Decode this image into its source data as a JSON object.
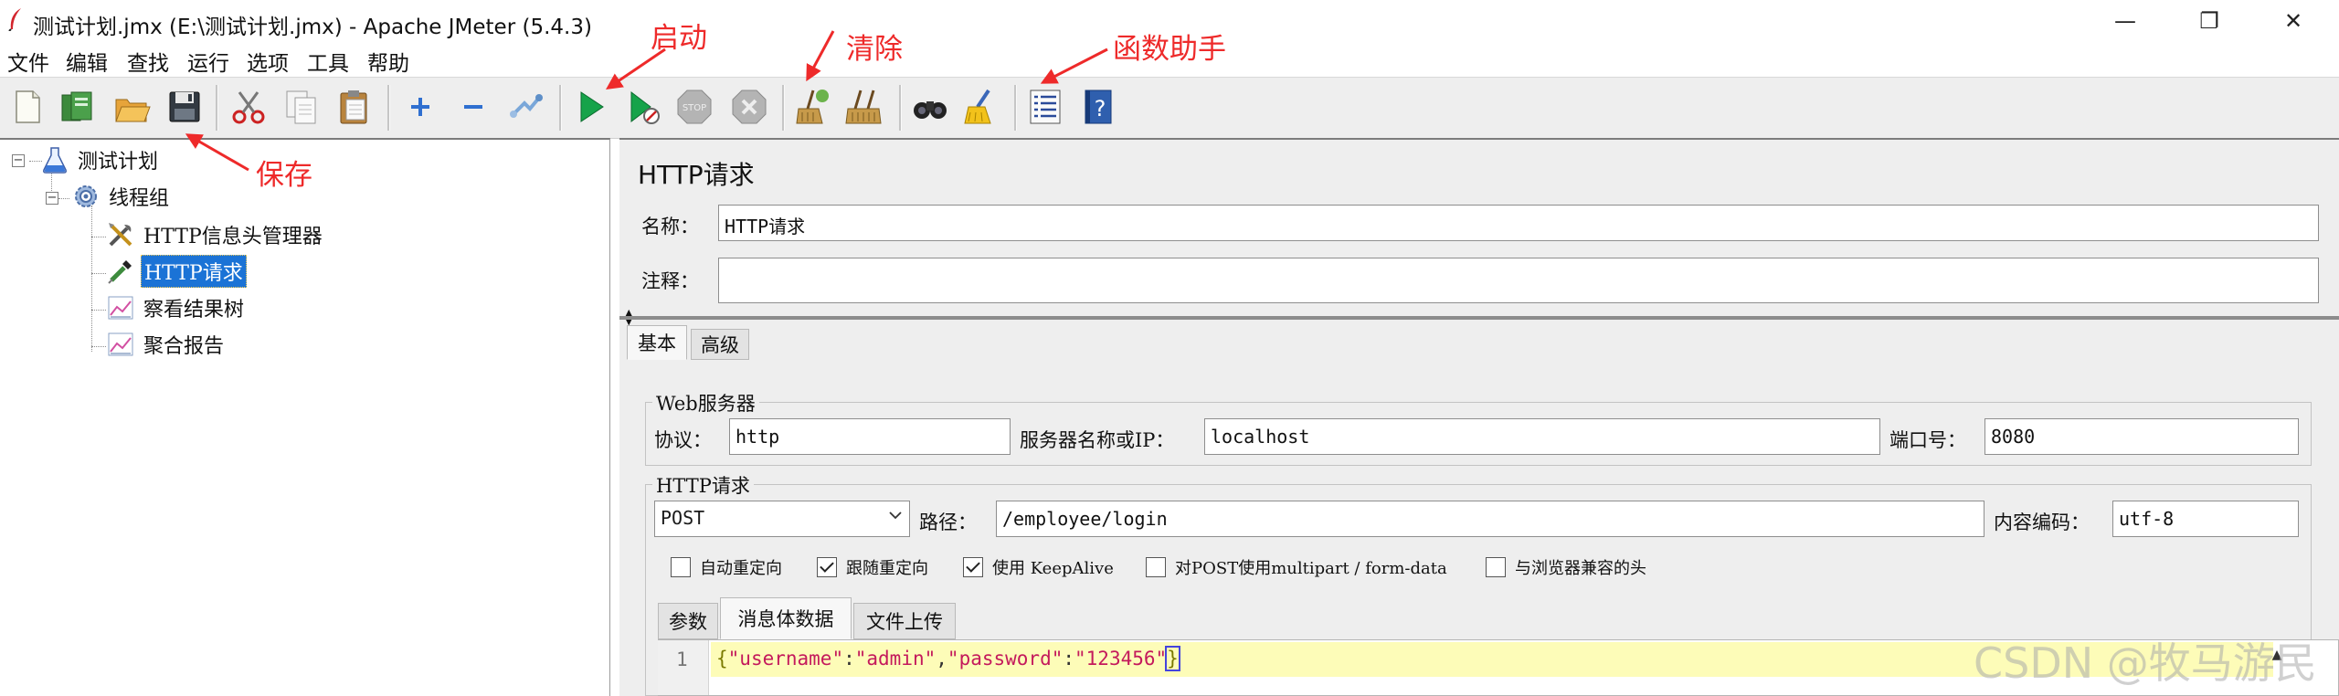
{
  "window": {
    "title": "测试计划.jmx (E:\\测试计划.jmx) - Apache JMeter (5.4.3)",
    "controls": {
      "minimize": "—",
      "maximize": "❐",
      "close": "✕"
    }
  },
  "menu": [
    "文件",
    "编辑",
    "查找",
    "运行",
    "选项",
    "工具",
    "帮助"
  ],
  "toolbar": {
    "icons": [
      "new-icon",
      "templates-icon",
      "open-icon",
      "save-icon",
      "cut-icon",
      "copy-icon",
      "paste-icon",
      "expand-icon",
      "collapse-icon",
      "toggle-icon",
      "start-icon",
      "start-no-pause-icon",
      "stop-icon",
      "shutdown-icon",
      "clear-icon",
      "clear-all-icon",
      "search-icon",
      "reset-search-icon",
      "function-helper-icon",
      "help-icon"
    ]
  },
  "annotations": {
    "save": "保存",
    "start": "启动",
    "clear": "清除",
    "function_helper": "函数助手",
    "color": "#ee2a2a"
  },
  "tree": {
    "nodes": [
      {
        "label": "测试计划",
        "icon": "flask-icon"
      },
      {
        "label": "线程组",
        "icon": "gear-icon"
      },
      {
        "label": "HTTP信息头管理器",
        "icon": "tools-icon"
      },
      {
        "label": "HTTP请求",
        "icon": "pipette-icon",
        "selected": true
      },
      {
        "label": "察看结果树",
        "icon": "graph-icon"
      },
      {
        "label": "聚合报告",
        "icon": "graph-icon"
      }
    ],
    "toggle_symbol": "−"
  },
  "panel": {
    "title": "HTTP请求",
    "name_label": "名称：",
    "name_value": "HTTP请求",
    "comment_label": "注释：",
    "comment_value": "",
    "tabs": [
      "基本",
      "高级"
    ],
    "web_server": {
      "title": "Web服务器",
      "protocol_label": "协议：",
      "protocol_value": "http",
      "server_label": "服务器名称或IP：",
      "server_value": "localhost",
      "port_label": "端口号：",
      "port_value": "8080"
    },
    "http_request": {
      "title": "HTTP请求",
      "method": "POST",
      "path_label": "路径：",
      "path_value": "/employee/login",
      "encoding_label": "内容编码：",
      "encoding_value": "utf-8"
    },
    "checkboxes": [
      {
        "label": "自动重定向",
        "checked": false
      },
      {
        "label": "跟随重定向",
        "checked": true
      },
      {
        "label": "使用 KeepAlive",
        "checked": true
      },
      {
        "label": "对POST使用multipart / form-data",
        "checked": false
      },
      {
        "label": "与浏览器兼容的头",
        "checked": false
      }
    ],
    "body_tabs": [
      "参数",
      "消息体数据",
      "文件上传"
    ],
    "editor": {
      "line_number": "1",
      "open_brace": "{",
      "k1": "\"username\"",
      "colon1": ":",
      "v1": "\"admin\"",
      "comma": ",",
      "k2": "\"password\"",
      "colon2": ":",
      "v2": "\"123456\"",
      "close_brace": "}"
    }
  },
  "watermark": "CSDN @牧马游民"
}
